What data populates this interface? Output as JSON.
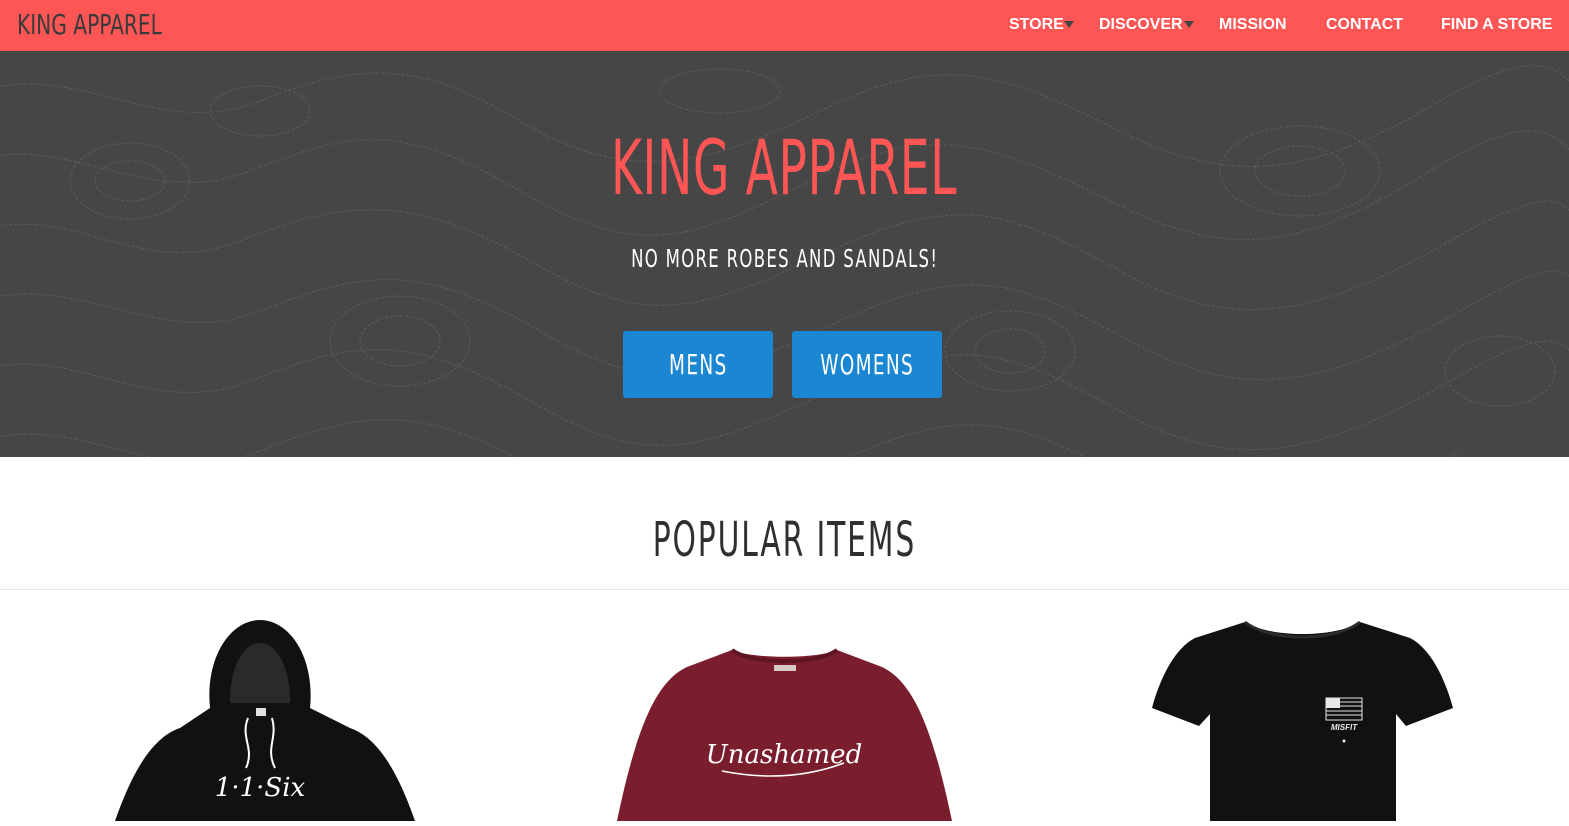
{
  "nav": {
    "brand": "KING APPAREL",
    "items": [
      {
        "label": "STORE",
        "has_dropdown": true
      },
      {
        "label": "DISCOVER",
        "has_dropdown": true
      },
      {
        "label": "MISSION",
        "has_dropdown": false
      },
      {
        "label": "CONTACT",
        "has_dropdown": false
      },
      {
        "label": "FIND A STORE",
        "has_dropdown": false
      }
    ]
  },
  "hero": {
    "title": "KING APPAREL",
    "subtitle": "NO MORE ROBES AND SANDALS!",
    "buttons": [
      {
        "label": "MENS"
      },
      {
        "label": "WOMENS"
      }
    ]
  },
  "popular": {
    "title": "POPULAR ITEMS",
    "products": [
      {
        "print": "1·1·Six",
        "garment": "black hoodie"
      },
      {
        "print": "Unashamed",
        "garment": "maroon sweatshirt"
      },
      {
        "print": "MISFIT",
        "garment": "black t-shirt"
      }
    ]
  },
  "colors": {
    "brand_red": "#fe5555",
    "hero_bg": "#464646",
    "button_blue": "#1b86d2",
    "maroon": "#7a1e2e"
  }
}
